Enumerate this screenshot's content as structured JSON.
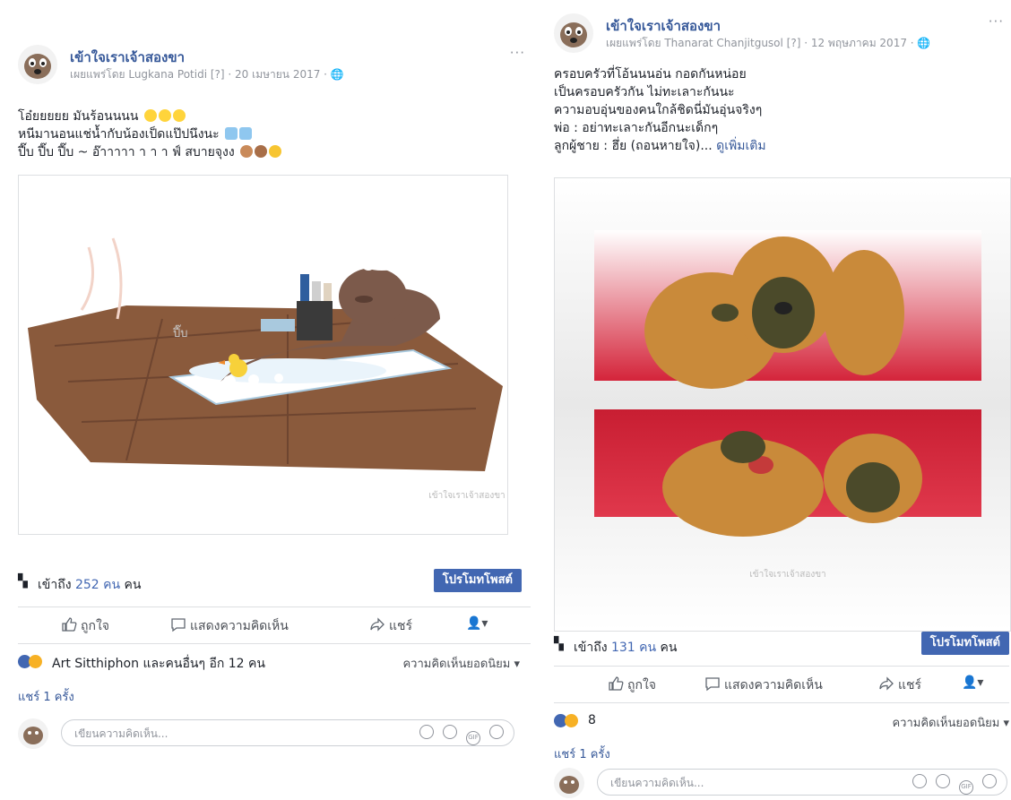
{
  "postA": {
    "page_name": "เข้าใจเราเจ้าสองขา",
    "meta": "เผยแพร่โดย Lugkana Potidi [?] · 20 เมษายน 2017 · ",
    "more": "···",
    "text_lines": [
      "โอ๋ยยยยย มันร้อนนนน",
      "หนีมานอนแช่น้ำกับน้องเป็ดแป๊ปนึงนะ",
      "ปี๊บ ปี๊บ ปี๊บ ~ อ๊าาาาา า า า ฟ์ สบายจุงง"
    ],
    "image_text": "ปี๊บ",
    "watermark": "เข้าใจเราเจ้าสองขา",
    "reach_prefix": "เข้าถึง ",
    "reach_number": "252 คน",
    "reach_suffix": " คน",
    "boost_label": "โปรโมทโพสต์",
    "like_label": "ถูกใจ",
    "comment_label": "แสดงความคิดเห็น",
    "share_label": "แชร์",
    "reactions_text": "Art Sitthiphon และคนอื่นๆ อีก 12 คน",
    "sort_label": "ความคิดเห็นยอดนิยม ▾",
    "shares_text": "แชร์ 1 ครั้ง",
    "comment_placeholder": "เขียนความคิดเห็น..."
  },
  "postB": {
    "page_name": "เข้าใจเราเจ้าสองขา",
    "meta": "เผยแพร่โดย Thanarat Chanjitgusol [?] · 12 พฤษภาคม 2017 · ",
    "more": "···",
    "text_lines": [
      "ครอบครัวที่โอ้นนนอ่น กอดกันหน่อย",
      "เป็นครอบครัวกัน ไม่ทะเลาะกันนะ",
      "ความอบอุ่นของคนใกล้ชิดนี่มันอุ่นจริงๆ",
      "พ่อ : อย่าทะเลาะกันอีกนะเด็กๆ",
      "ลูกผู้ชาย : ฮึ่ย (ถอนหายใจ)..."
    ],
    "see_more": "ดูเพิ่มเติม",
    "watermark": "เข้าใจเราเจ้าสองขา",
    "reach_prefix": "เข้าถึง ",
    "reach_number": "131 คน",
    "reach_suffix": " คน",
    "boost_label": "โปรโมทโพสต์",
    "like_label": "ถูกใจ",
    "comment_label": "แสดงความคิดเห็น",
    "share_label": "แชร์",
    "reactions_text": "8",
    "sort_label": "ความคิดเห็นยอดนิยม ▾",
    "shares_text": "แชร์ 1 ครั้ง",
    "comment_placeholder": "เขียนความคิดเห็น..."
  },
  "icons": {
    "globe": "globe-icon",
    "like": "thumbs-up-icon",
    "comment": "speech-bubble-icon",
    "share": "share-arrow-icon",
    "reach": "people-icon",
    "emoji": "smiley-icon",
    "camera": "camera-icon",
    "gif": "gif-icon",
    "sticker": "sticker-icon",
    "actor": "avatar-selector-icon"
  },
  "colors": {
    "link": "#365899",
    "brand": "#4267b2",
    "reaction_like": "#4267b2",
    "reaction_haha": "#f7b125",
    "muted": "#90949c"
  }
}
